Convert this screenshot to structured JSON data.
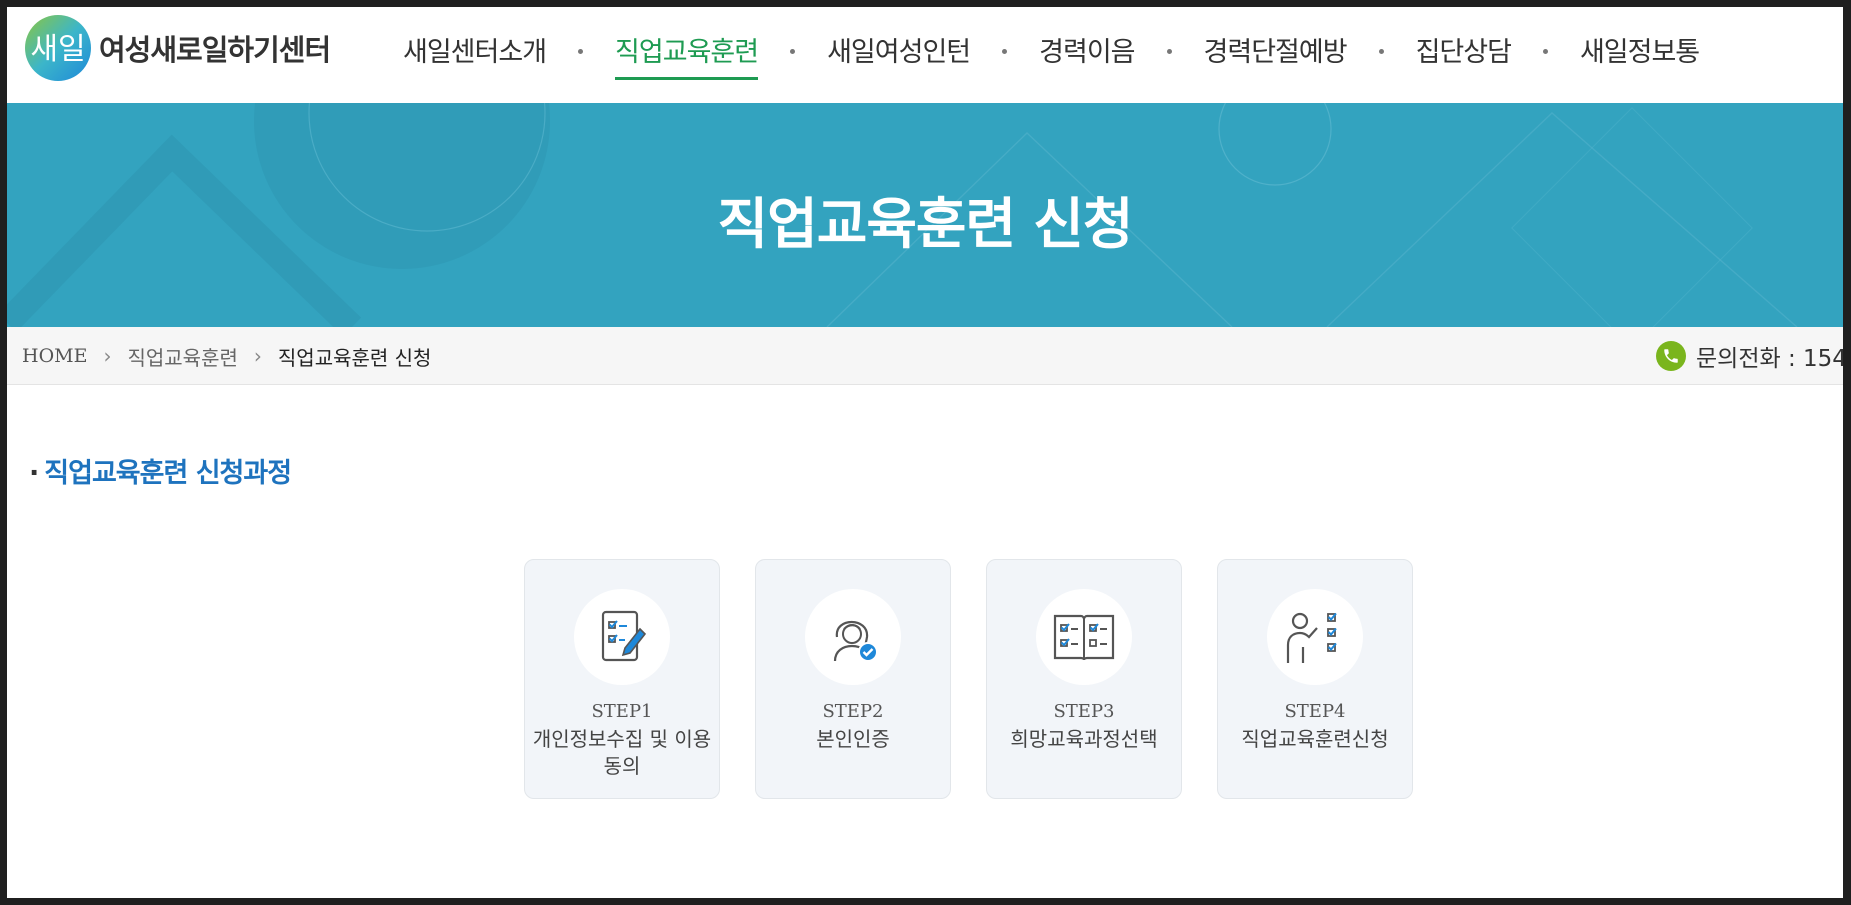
{
  "logo": {
    "mark_text": "새일",
    "text": "여성새로일하기센터"
  },
  "gnb": {
    "items": [
      {
        "label": "새일센터소개",
        "active": false
      },
      {
        "label": "직업교육훈련",
        "active": true
      },
      {
        "label": "새일여성인턴",
        "active": false
      },
      {
        "label": "경력이음",
        "active": false
      },
      {
        "label": "경력단절예방",
        "active": false
      },
      {
        "label": "집단상담",
        "active": false
      },
      {
        "label": "새일정보통",
        "active": false
      }
    ]
  },
  "banner": {
    "title": "직업교육훈련 신청"
  },
  "breadcrumb": {
    "home": "HOME",
    "sep": "›",
    "level1": "직업교육훈련",
    "current": "직업교육훈련 신청"
  },
  "contact": {
    "label": "문의전화 : 154"
  },
  "section": {
    "bullet": "·",
    "title": "직업교육훈련 신청과정"
  },
  "steps": [
    {
      "no": "STEP1",
      "label": "개인정보수집 및 이용동의",
      "icon": "checklist-pen-icon"
    },
    {
      "no": "STEP2",
      "label": "본인인증",
      "icon": "person-verified-icon"
    },
    {
      "no": "STEP3",
      "label": "희망교육과정선택",
      "icon": "open-book-checklist-icon"
    },
    {
      "no": "STEP4",
      "label": "직업교육훈련신청",
      "icon": "presenter-checklist-icon"
    }
  ],
  "colors": {
    "active_nav": "#1e9b52",
    "banner_bg": "#33a3bf",
    "section_title": "#1e73be",
    "phone_icon": "#7ab51d",
    "step_card_bg": "#f2f5f9",
    "icon_accent": "#1e88d9"
  }
}
